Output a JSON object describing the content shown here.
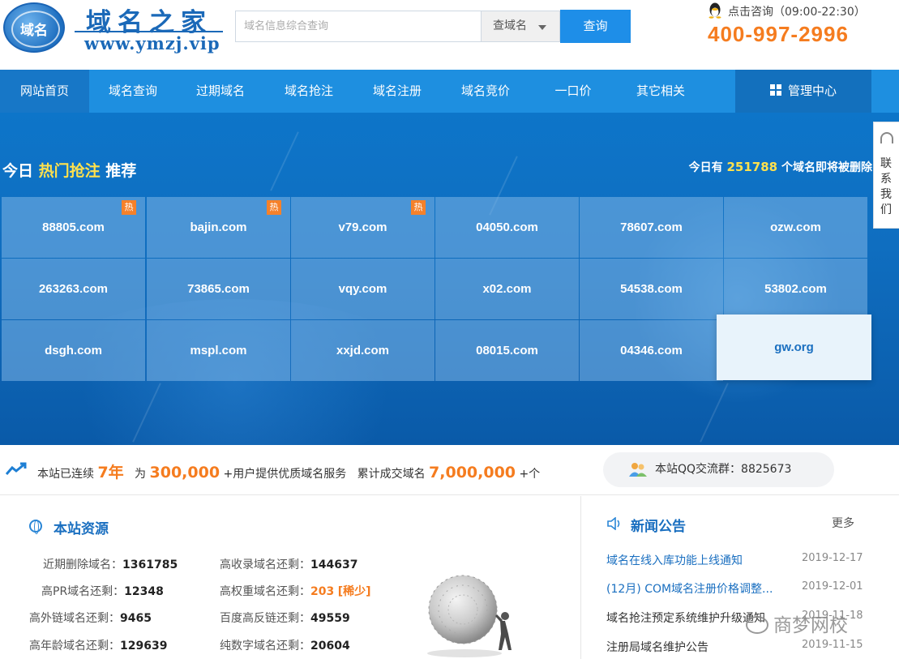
{
  "header": {
    "logo_globe_text": "域名",
    "logo_cn": "域名之家",
    "logo_url": "www.ymzj.vip",
    "search_placeholder": "域名信息综合查询",
    "search_type": "查域名",
    "search_button": "查询",
    "consult_text": "点击咨询（09:00-22:30）",
    "hotline": "400-997-2996"
  },
  "nav": {
    "items": [
      "网站首页",
      "域名查询",
      "过期域名",
      "域名抢注",
      "域名注册",
      "域名竞价",
      "一口价",
      "其它相关"
    ],
    "active_index": 0,
    "admin": "管理中心"
  },
  "banner": {
    "title_prefix": "今日",
    "title_highlight": "热门抢注",
    "title_suffix": "推荐",
    "delete_prefix": "今日有",
    "delete_count": "251788",
    "delete_suffix": "个域名即将被删除",
    "hot_badge": "热",
    "domains": [
      {
        "name": "88805.com",
        "hot": true
      },
      {
        "name": "bajin.com",
        "hot": true
      },
      {
        "name": "v79.com",
        "hot": true
      },
      {
        "name": "04050.com",
        "hot": false
      },
      {
        "name": "78607.com",
        "hot": false
      },
      {
        "name": "ozw.com",
        "hot": false
      },
      {
        "name": "263263.com",
        "hot": false
      },
      {
        "name": "73865.com",
        "hot": false
      },
      {
        "name": "vqy.com",
        "hot": false
      },
      {
        "name": "x02.com",
        "hot": false
      },
      {
        "name": "54538.com",
        "hot": false
      },
      {
        "name": "53802.com",
        "hot": false
      },
      {
        "name": "dsgh.com",
        "hot": false
      },
      {
        "name": "mspl.com",
        "hot": false
      },
      {
        "name": "xxjd.com",
        "hot": false
      },
      {
        "name": "08015.com",
        "hot": false
      },
      {
        "name": "04346.com",
        "hot": false
      },
      {
        "name": "gw.org",
        "hot": false,
        "featured": true
      }
    ]
  },
  "side_tab": {
    "text": "联系我们"
  },
  "stats": {
    "p1": "本站已连续",
    "years": "7年",
    "p2": "为",
    "users": "300,000",
    "p3": "+用户提供优质域名服务",
    "p4": "累计成交域名",
    "deals": "7,000,000",
    "p5": "+个",
    "qq_group": "本站QQ交流群：8825673"
  },
  "resources": {
    "title": "本站资源",
    "rows": [
      {
        "label": "近期删除域名：",
        "value": "1361785"
      },
      {
        "label": "高收录域名还剩：",
        "value": "144637"
      },
      {
        "label": "高PR域名还剩：",
        "value": "12348"
      },
      {
        "label": "高权重域名还剩：",
        "value": "203",
        "extra": "[稀少]"
      },
      {
        "label": "高外链域名还剩：",
        "value": "9465"
      },
      {
        "label": "百度高反链还剩：",
        "value": "49559"
      },
      {
        "label": "高年龄域名还剩：",
        "value": "129639"
      },
      {
        "label": "纯数字域名还剩：",
        "value": "20604"
      }
    ]
  },
  "news": {
    "title": "新闻公告",
    "more": "更多",
    "items": [
      {
        "title": "域名在线入库功能上线通知",
        "date": "2019-12-17",
        "color": "#1a6fc0"
      },
      {
        "title": "(12月) COM域名注册价格调整...",
        "date": "2019-12-01",
        "color": "#1a6fc0"
      },
      {
        "title": "域名抢注预定系统维护升级通知",
        "date": "2019-11-18",
        "color": "#333333"
      },
      {
        "title": "注册局域名维护公告",
        "date": "2019-11-15",
        "color": "#333333"
      }
    ],
    "watermark": "商梦网校"
  }
}
